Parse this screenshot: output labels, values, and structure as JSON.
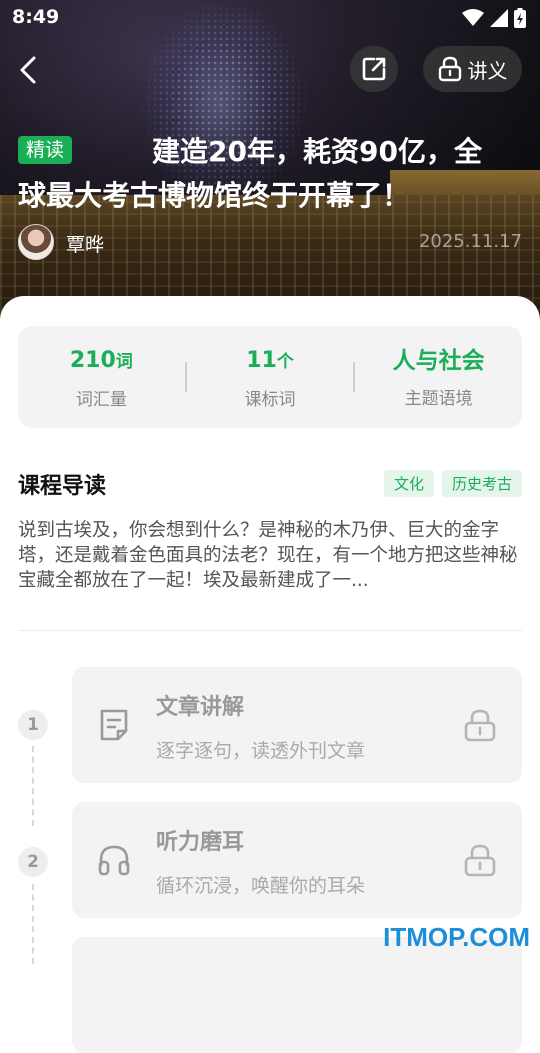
{
  "status_bar": {
    "time": "8:49"
  },
  "header": {
    "notes_label": "讲义"
  },
  "article": {
    "badge": "精读",
    "title": "建造20年，耗资90亿，全球最大考古博物馆终于开幕了！",
    "author": "覃晔",
    "date": "2025.11.17"
  },
  "stats": [
    {
      "number": "210",
      "unit": "词",
      "label": "词汇量"
    },
    {
      "number": "11",
      "unit": "个",
      "label": "课标词"
    },
    {
      "number": "人与社会",
      "unit": "",
      "label": "主题语境"
    }
  ],
  "intro": {
    "title": "课程导读",
    "tags": [
      "文化",
      "历史考古"
    ],
    "text": "说到古埃及，你会想到什么？是神秘的木乃伊、巨大的金字塔，还是戴着金色面具的法老？现在，有一个地方把这些神秘宝藏全都放在了一起！埃及最新建成了一..."
  },
  "steps": [
    {
      "number": "1",
      "title": "文章讲解",
      "subtitle": "逐字逐句，读透外刊文章",
      "icon": "document-icon",
      "locked": true
    },
    {
      "number": "2",
      "title": "听力磨耳",
      "subtitle": "循环沉浸，唤醒你的耳朵",
      "icon": "headphones-icon",
      "locked": true
    }
  ],
  "watermark": "ITMOP.COM",
  "colors": {
    "accent": "#1aae57",
    "card_bg": "#f3f3f3",
    "watermark": "#1e8fd6"
  }
}
